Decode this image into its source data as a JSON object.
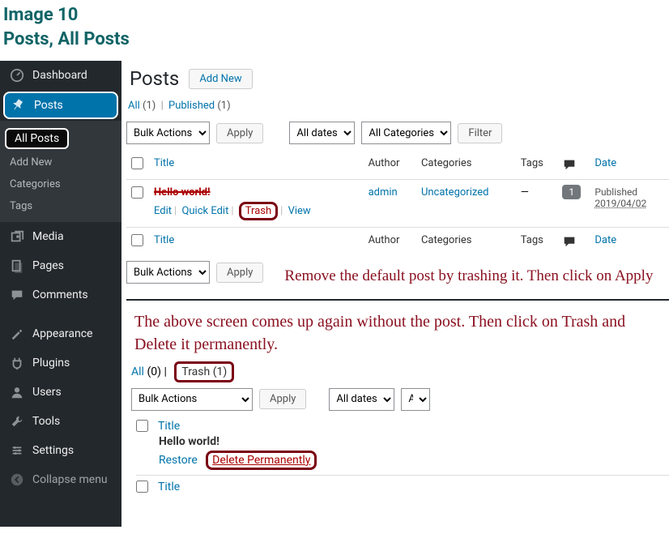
{
  "doc_heading": {
    "line1": "Image 10",
    "line2": "Posts, All Posts"
  },
  "sidebar": {
    "dashboard": "Dashboard",
    "posts": "Posts",
    "sub": {
      "all_posts": "All Posts",
      "add_new": "Add New",
      "categories": "Categories",
      "tags": "Tags"
    },
    "media": "Media",
    "pages": "Pages",
    "comments": "Comments",
    "appearance": "Appearance",
    "plugins": "Plugins",
    "users": "Users",
    "tools": "Tools",
    "settings": "Settings",
    "collapse": "Collapse menu"
  },
  "page": {
    "title": "Posts",
    "add_new": "Add New"
  },
  "status1": {
    "all_label": "All",
    "all_count": "(1)",
    "published_label": "Published",
    "published_count": "(1)"
  },
  "toolbar": {
    "bulk": "Bulk Actions",
    "apply": "Apply",
    "dates": "All dates",
    "cats": "All Categories",
    "filter": "Filter"
  },
  "cols": {
    "title": "Title",
    "author": "Author",
    "categories": "Categories",
    "tags": "Tags",
    "date": "Date"
  },
  "row1": {
    "title": "Hello world!",
    "author": "admin",
    "category": "Uncategorized",
    "tags": "—",
    "comments": "1",
    "date_status": "Published",
    "date": "2019/04/02",
    "actions": {
      "edit": "Edit",
      "quick_edit": "Quick Edit",
      "trash": "Trash",
      "view": "View"
    }
  },
  "ann1": "Remove the default post by trashing it. Then click on Apply",
  "ann2": "The above screen comes up again without the post. Then click on Trash and Delete it permanently.",
  "status2": {
    "all_label": "All",
    "all_count": "(0)",
    "trash_label": "Trash",
    "trash_count": "(1)"
  },
  "toolbar2": {
    "bulk": "Bulk Actions",
    "apply": "Apply",
    "dates": "All dates",
    "cats_trunc": "Al"
  },
  "trash_list": {
    "title_col": "Title",
    "post_title": "Hello world!",
    "restore": "Restore",
    "del_perm": "Delete Permanently"
  }
}
